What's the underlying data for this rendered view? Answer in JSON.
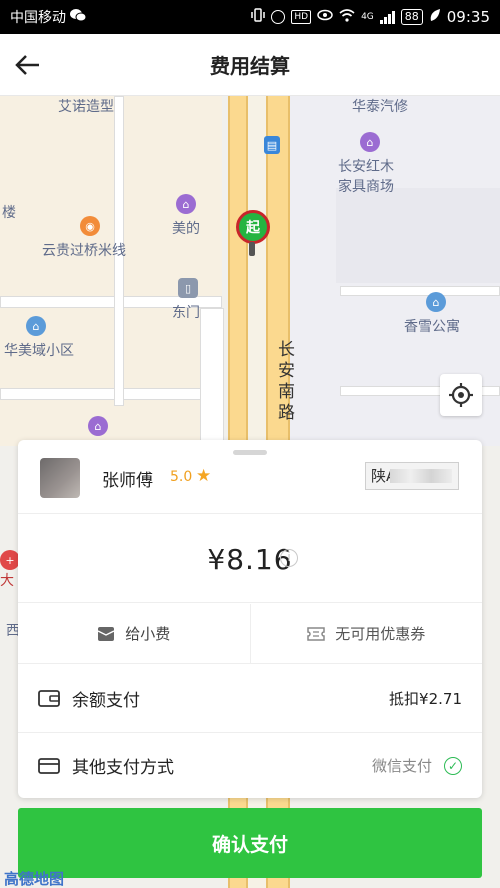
{
  "status_bar": {
    "carrier": "中国移动",
    "network": "4G",
    "battery": "88",
    "time": "09:35"
  },
  "header": {
    "title": "费用结算"
  },
  "map": {
    "labels": {
      "aino": "艾诺造型",
      "huatai": "华泰汽修",
      "changan_hongmu_1": "长安红木",
      "changan_hongmu_2": "家具商场",
      "lou": "楼",
      "meide": "美的",
      "yungui": "云贵过桥米线",
      "dongmen": "东门",
      "xiangxue": "香雪公寓",
      "huameiyu": "华美域小区",
      "road": "长安南路",
      "da": "大",
      "xi": "西"
    },
    "start_marker": "起",
    "logo": "高德地图"
  },
  "driver": {
    "name": "张师傅",
    "rating": "5.0",
    "plate_prefix": "陕A"
  },
  "fare": {
    "amount": "¥8.16"
  },
  "actions": {
    "tip": "给小费",
    "coupon": "无可用优惠券"
  },
  "payment": {
    "balance_label": "余额支付",
    "balance_value": "抵扣¥2.71",
    "other_label": "其他支付方式",
    "other_value": "微信支付"
  },
  "confirm_button": "确认支付",
  "colors": {
    "primary_green": "#2fc441",
    "rating_orange": "#f5a623",
    "road_yellow": "#fbd98f"
  }
}
